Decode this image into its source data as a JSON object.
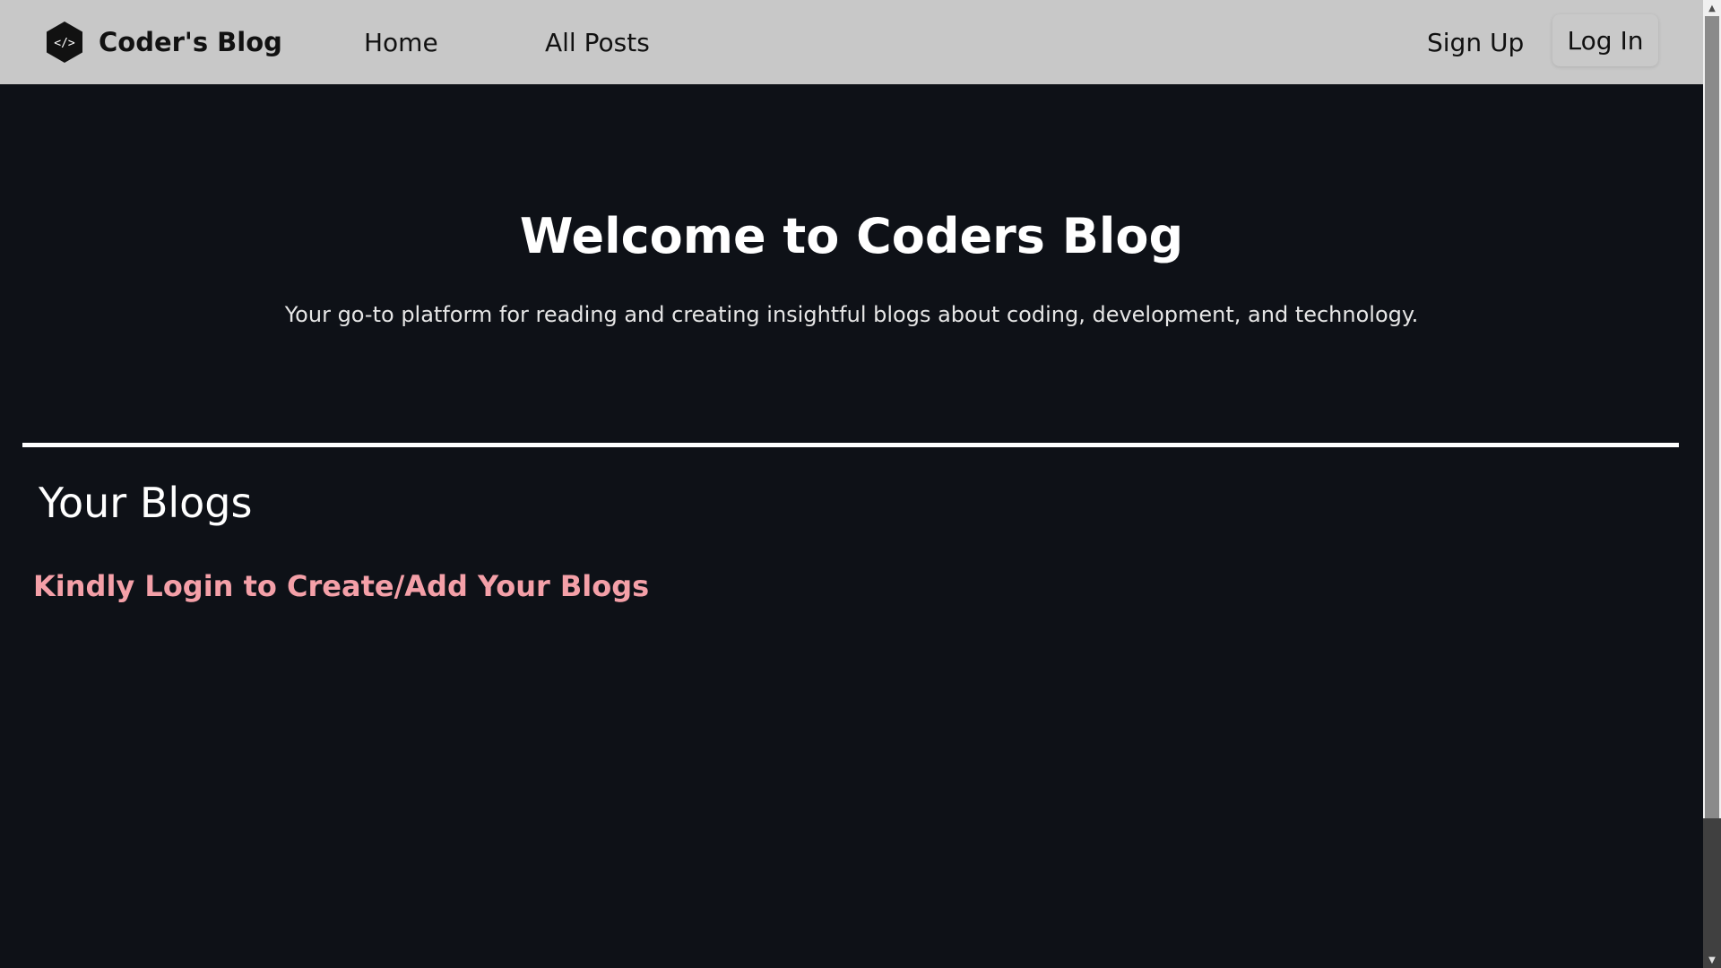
{
  "navbar": {
    "brand_name": "Coder's Blog",
    "brand_icon": "code-hexagon-icon",
    "home_label": "Home",
    "all_posts_label": "All Posts",
    "signup_label": "Sign Up",
    "login_label": "Log In"
  },
  "hero": {
    "title": "Welcome to Coders Blog",
    "subtitle": "Your go-to platform for reading and creating insightful blogs about coding, development, and technology."
  },
  "blogs_section": {
    "title": "Your Blogs",
    "login_prompt": "Kindly Login to Create/Add Your Blogs"
  },
  "colors": {
    "background": "#0e1117",
    "navbar": "#c8c8c8",
    "prompt": "#f4a0a8",
    "text": "#ffffff"
  }
}
